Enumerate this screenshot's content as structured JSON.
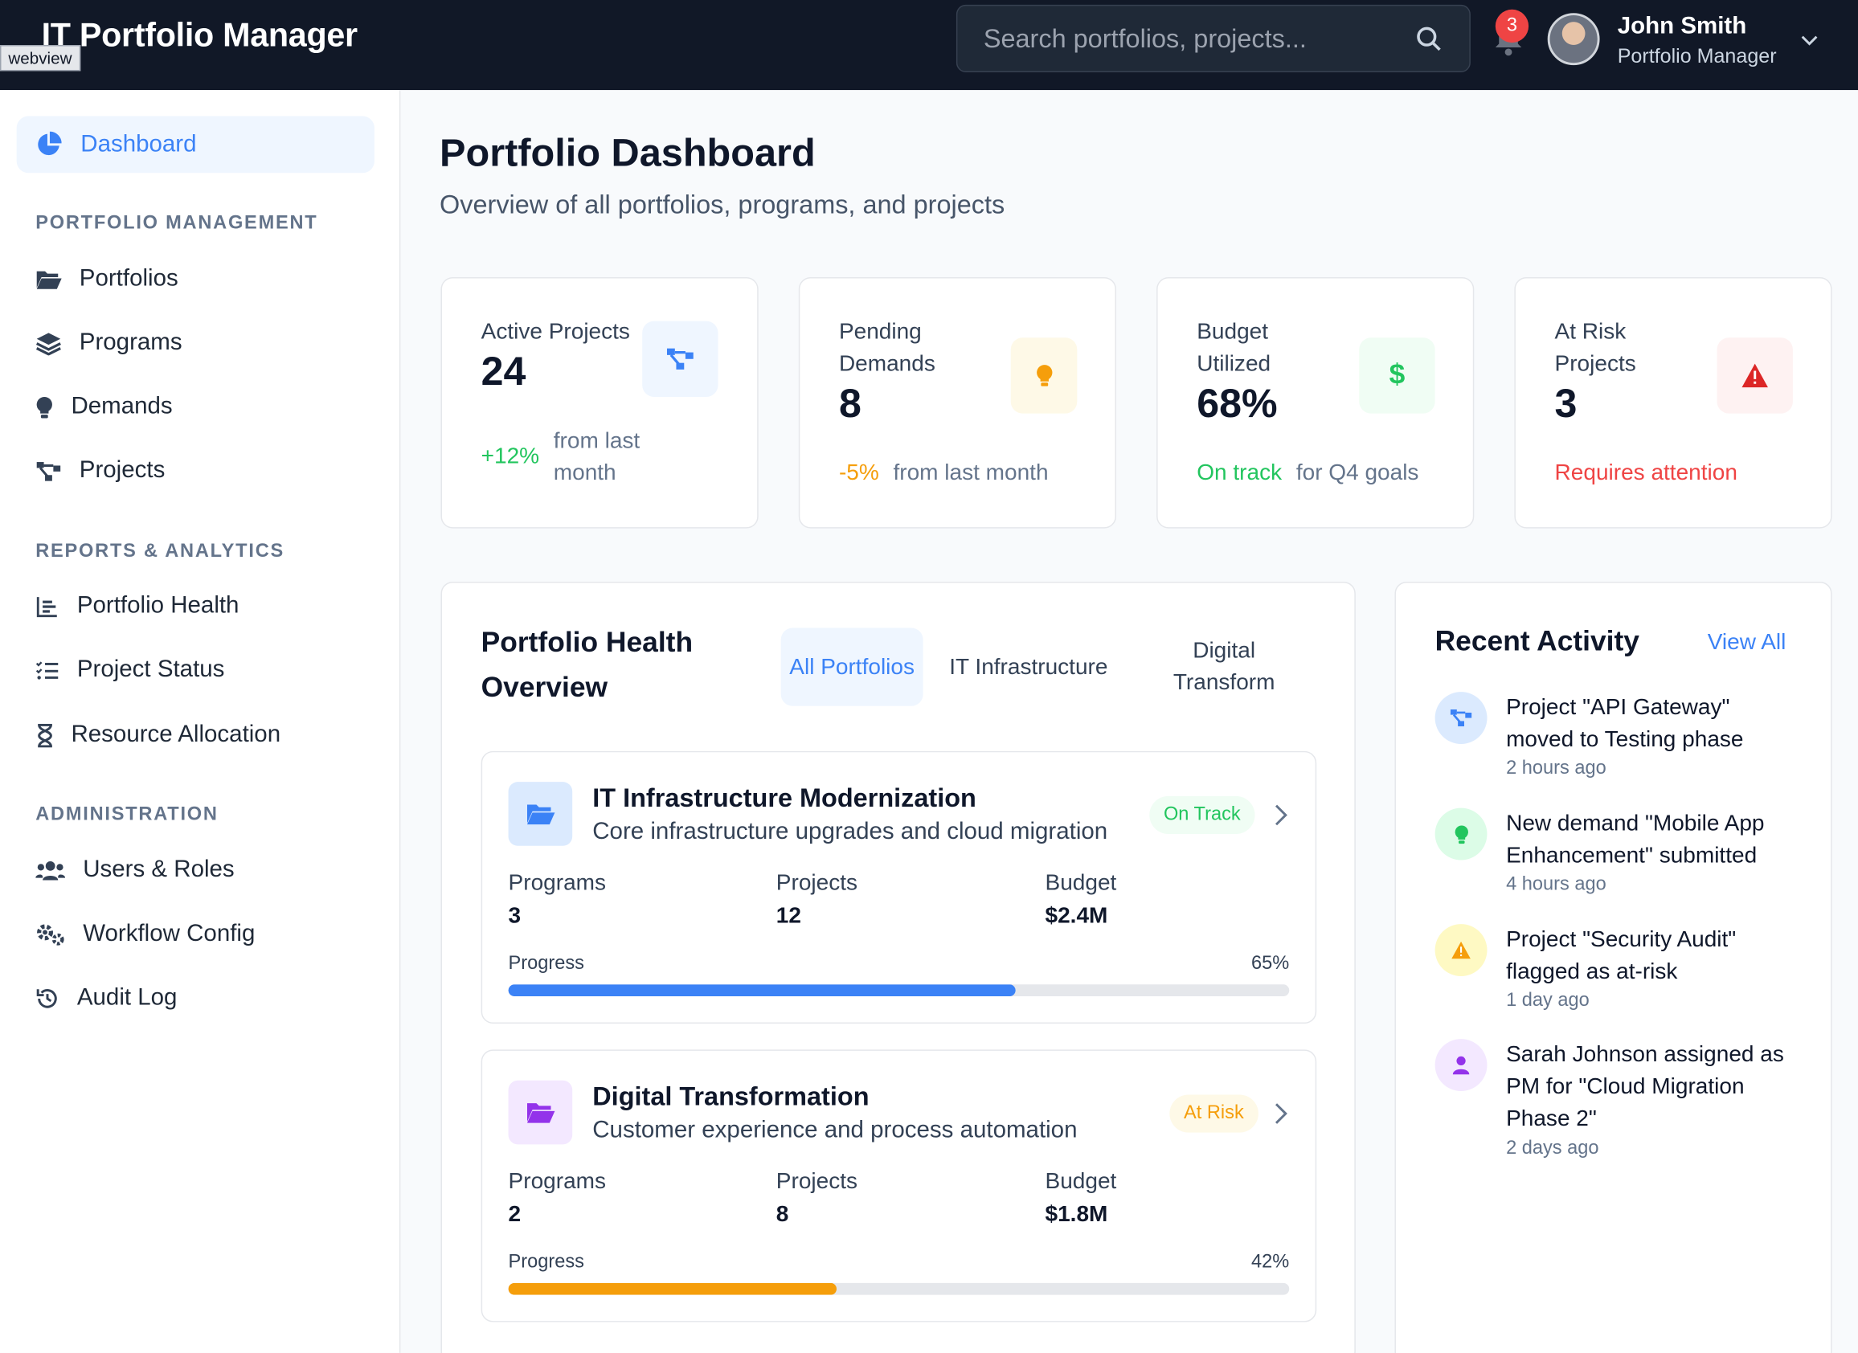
{
  "app": {
    "title": "IT Portfolio Manager",
    "webview_tag": "webview"
  },
  "search": {
    "placeholder": "Search portfolios, projects..."
  },
  "notifications": {
    "count": "3"
  },
  "user": {
    "name": "John Smith",
    "role": "Portfolio Manager"
  },
  "sidebar": {
    "active": {
      "label": "Dashboard",
      "icon": "pie-chart-icon"
    },
    "sections": [
      {
        "title": "PORTFOLIO MANAGEMENT"
      },
      {
        "title": "REPORTS & ANALYTICS"
      },
      {
        "title": "ADMINISTRATION"
      }
    ],
    "items": [
      {
        "label": "Portfolios",
        "icon": "folder-icon"
      },
      {
        "label": "Programs",
        "icon": "layers-icon"
      },
      {
        "label": "Demands",
        "icon": "lightbulb-icon"
      },
      {
        "label": "Projects",
        "icon": "project-diagram-icon"
      },
      {
        "label": "Portfolio Health",
        "icon": "bar-chart-icon"
      },
      {
        "label": "Project Status",
        "icon": "task-list-icon"
      },
      {
        "label": "Resource Allocation",
        "icon": "hourglass-icon"
      },
      {
        "label": "Users & Roles",
        "icon": "users-icon"
      },
      {
        "label": "Workflow Config",
        "icon": "gears-icon"
      },
      {
        "label": "Audit Log",
        "icon": "history-icon"
      }
    ]
  },
  "page": {
    "title": "Portfolio Dashboard",
    "subtitle": "Overview of all portfolios, programs, and projects"
  },
  "stats": [
    {
      "label": "Active Projects",
      "value": "24",
      "delta": "+12%",
      "foot": "from last month",
      "icon": "project-diagram-icon",
      "accent": "#22c55e"
    },
    {
      "label": "Pending Demands",
      "value": "8",
      "delta": "-5%",
      "foot": "from last month",
      "icon": "lightbulb-icon",
      "accent": "#f59e0b"
    },
    {
      "label": "Budget Utilized",
      "value": "68%",
      "delta": "On track",
      "foot": "for Q4 goals",
      "icon": "dollar-icon",
      "accent": "#22c55e"
    },
    {
      "label": "At Risk Projects",
      "value": "3",
      "delta": "Requires attention",
      "foot": "",
      "icon": "warning-icon",
      "accent": "#ef4444"
    }
  ],
  "health": {
    "title": "Portfolio Health Overview",
    "tabs": [
      {
        "label": "All Portfolios",
        "active": true
      },
      {
        "label": "IT Infrastructure",
        "active": false
      },
      {
        "label": "Digital Transform",
        "active": false
      }
    ],
    "portfolios": [
      {
        "name": "IT Infrastructure Modernization",
        "description": "Core infrastructure upgrades and cloud migration",
        "status": "On Track",
        "programs_label": "Programs",
        "programs": "3",
        "projects_label": "Projects",
        "projects": "12",
        "budget_label": "Budget",
        "budget": "$2.4M",
        "progress_label": "Progress",
        "progress": "65%",
        "progress_value": 65,
        "color": "#3b82f6"
      },
      {
        "name": "Digital Transformation",
        "description": "Customer experience and process automation",
        "status": "At Risk",
        "programs_label": "Programs",
        "programs": "2",
        "projects_label": "Projects",
        "projects": "8",
        "budget_label": "Budget",
        "budget": "$1.8M",
        "progress_label": "Progress",
        "progress": "42%",
        "progress_value": 42,
        "color": "#f59e0b"
      }
    ]
  },
  "activity": {
    "title": "Recent Activity",
    "view_all": "View All",
    "items": [
      {
        "text": "Project \"API Gateway\" moved to Testing phase",
        "time": "2 hours ago",
        "icon": "project-diagram-icon"
      },
      {
        "text": "New demand \"Mobile App Enhancement\" submitted",
        "time": "4 hours ago",
        "icon": "lightbulb-icon"
      },
      {
        "text": "Project \"Security Audit\" flagged as at-risk",
        "time": "1 day ago",
        "icon": "warning-icon"
      },
      {
        "text": "Sarah Johnson assigned as PM for \"Cloud Migration Phase 2\"",
        "time": "2 days ago",
        "icon": "user-icon"
      }
    ]
  }
}
